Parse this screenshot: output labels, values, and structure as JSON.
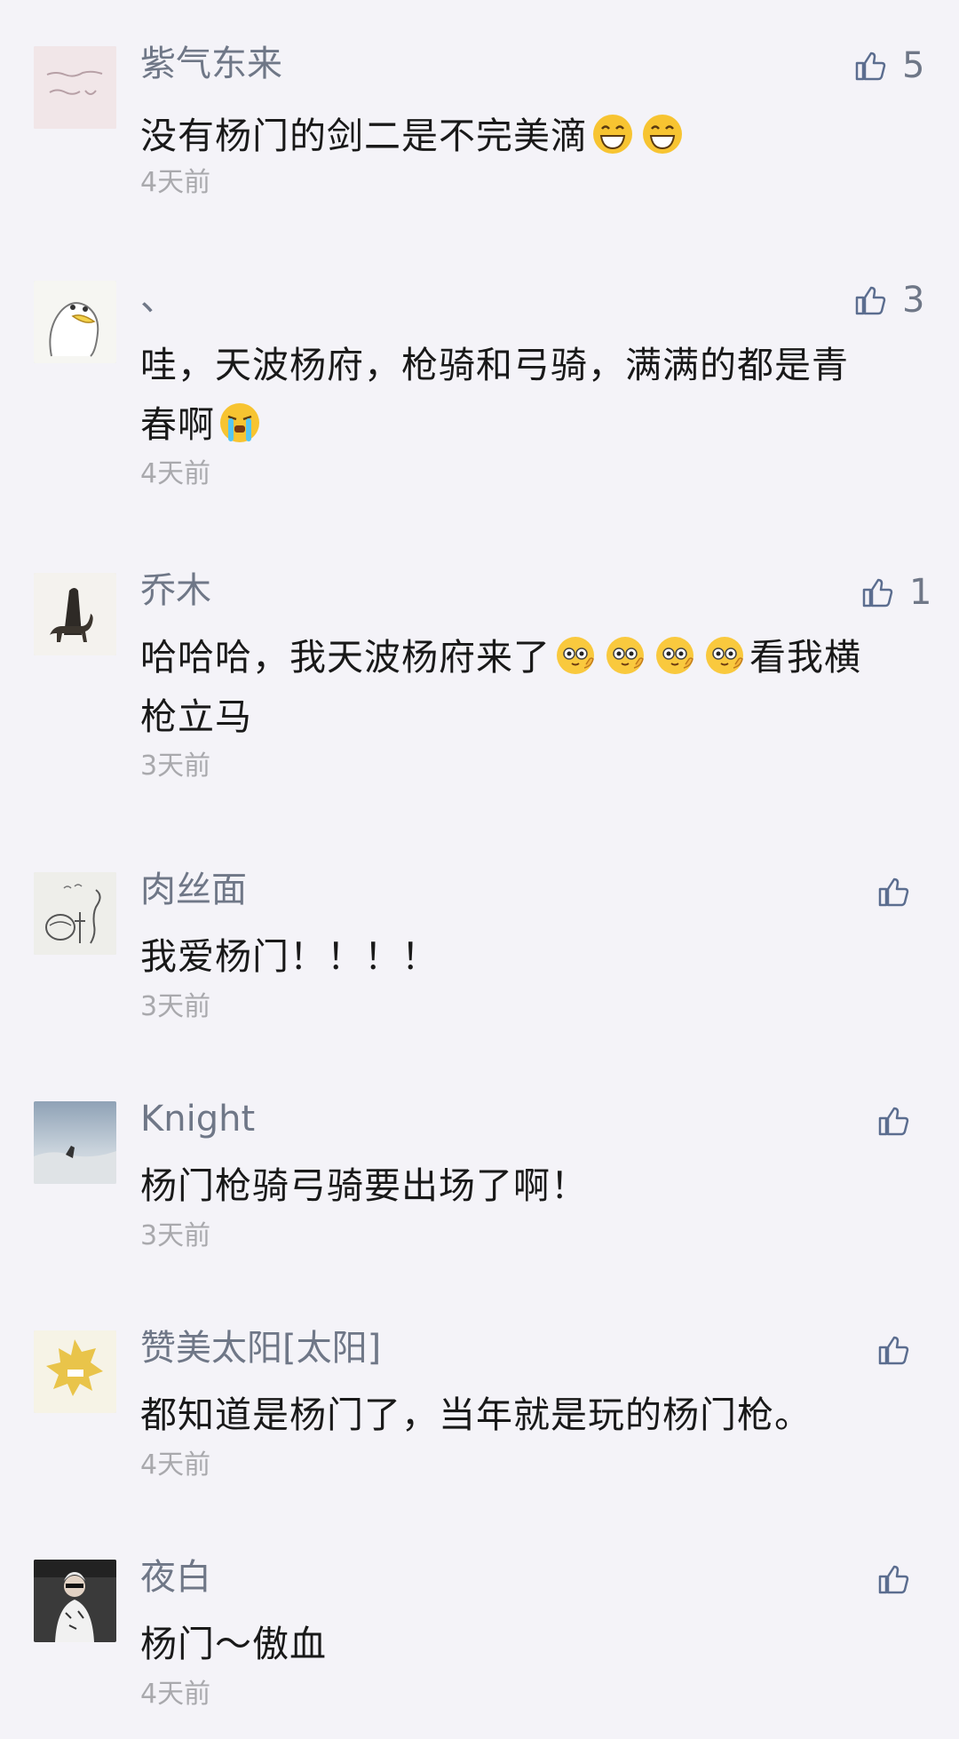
{
  "comments": [
    {
      "name": "紫气东来",
      "text_before": "没有杨门的剑二是不完美滴",
      "emoji_count": 2,
      "time": "4天前",
      "likes": "5"
    },
    {
      "name": "、",
      "text_line1": "哇，天波杨府，枪骑和弓骑，满满的都是青",
      "text_line2": "春啊",
      "time": "4天前",
      "likes": "3"
    },
    {
      "name": "乔木",
      "text_line1_a": "哈哈哈，我天波杨府来了",
      "text_line1_b": "看我横",
      "text_line2": "枪立马",
      "time": "3天前",
      "likes": "1"
    },
    {
      "name": "肉丝面",
      "text": "我爱杨门！！！！",
      "time": "3天前"
    },
    {
      "name": "Knight",
      "text": "杨门枪骑弓骑要出场了啊！",
      "time": "3天前"
    },
    {
      "name": "赞美太阳[太阳]",
      "text": "都知道是杨门了，当年就是玩的杨门枪。",
      "time": "4天前"
    },
    {
      "name": "夜白",
      "text": "杨门～傲血",
      "time": "4天前"
    }
  ],
  "icons": {
    "like": "thumbs-up-icon",
    "grin": "grinning-emoji-icon",
    "cry": "crying-emoji-icon",
    "shy": "shy-emoji-icon"
  },
  "colors": {
    "background": "#f4f3f8",
    "name": "#6f7787",
    "text": "#191919",
    "time": "#a9a9ad"
  }
}
